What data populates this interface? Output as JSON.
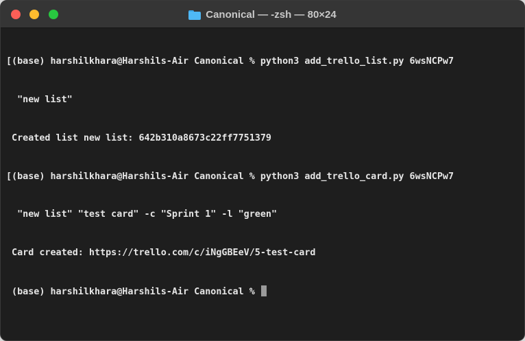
{
  "window": {
    "title": "Canonical — -zsh — 80×24",
    "folder_icon": "folder-icon"
  },
  "terminal": {
    "lines": [
      "[(base) harshilkhara@Harshils-Air Canonical % python3 add_trello_list.py 6wsNCPw7",
      "  \"new list\"",
      " Created list new list: 642b310a8673c22ff7751379",
      "[(base) harshilkhara@Harshils-Air Canonical % python3 add_trello_card.py 6wsNCPw7",
      "  \"new list\" \"test card\" -c \"Sprint 1\" -l \"green\"",
      " Card created: https://trello.com/c/iNgGBEeV/5-test-card",
      " (base) harshilkhara@Harshils-Air Canonical % "
    ]
  },
  "colors": {
    "background": "#1e1e1e",
    "titlebar": "#353535",
    "text": "#e6e6e6",
    "close": "#fe5f57",
    "minimize": "#febc2e",
    "zoom": "#28c840"
  }
}
